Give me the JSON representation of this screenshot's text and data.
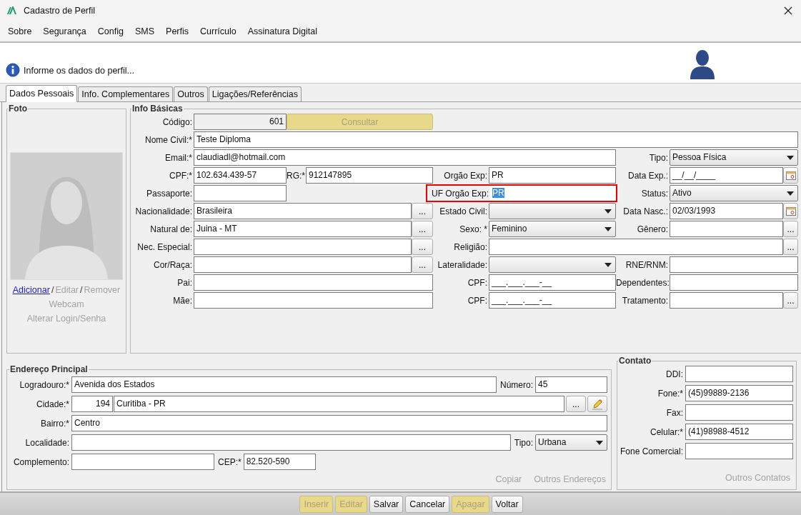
{
  "window": {
    "title": "Cadastro de Perfil"
  },
  "menu": [
    {
      "label": "Sobre"
    },
    {
      "label": "Segurança"
    },
    {
      "label": "Config"
    },
    {
      "label": "SMS"
    },
    {
      "label": "Perfis"
    },
    {
      "label": "Currículo"
    },
    {
      "label": "Assinatura Digital"
    }
  ],
  "header": {
    "message": "Informe os dados do perfil..."
  },
  "tabs": [
    {
      "label": "Dados Pessoais",
      "selected": true
    },
    {
      "label": "Info. Complementares",
      "selected": false
    },
    {
      "label": "Outros",
      "selected": false
    },
    {
      "label": "Ligações/Referências",
      "selected": false
    }
  ],
  "foto": {
    "title": "Foto",
    "actions": [
      {
        "kind": "link",
        "label": "Adicionar",
        "disabled": false
      },
      {
        "kind": "separator",
        "label": "/"
      },
      {
        "kind": "link",
        "label": "Editar",
        "disabled": true
      },
      {
        "kind": "separator",
        "label": "/"
      },
      {
        "kind": "link",
        "label": "Remover",
        "disabled": true
      }
    ],
    "more_links": [
      {
        "label": "Webcam",
        "disabled": true
      },
      {
        "label": "Alterar Login/Senha",
        "disabled": true
      }
    ]
  },
  "info_basicas": {
    "title": "Info Básicas",
    "fields": [
      {
        "kind": "number",
        "label": "Código:",
        "value": "601",
        "readonly": true
      },
      {
        "kind": "button",
        "label": "Consultar",
        "disabled": true
      },
      {
        "kind": "text",
        "label": "Nome Civil:*",
        "value": "Teste Diploma"
      },
      {
        "kind": "text",
        "label": "Email:*",
        "value": "claudiadl@hotmail.com"
      },
      {
        "kind": "select",
        "label": "Tipo:",
        "value": "Pessoa Física"
      },
      {
        "kind": "text",
        "label": "CPF:*",
        "value": "102.634.439-57"
      },
      {
        "kind": "text",
        "label": "RG:*",
        "value": "912147895"
      },
      {
        "kind": "text",
        "label": "Orgão Exp:",
        "value": "PR"
      },
      {
        "kind": "date",
        "label": "Data Exp.:",
        "value": "__/__/____"
      },
      {
        "kind": "text",
        "label": "Passaporte:"
      },
      {
        "kind": "text",
        "label": "UF Orgão Exp:",
        "value": "PR",
        "highlighted": true,
        "text_selected": true
      },
      {
        "kind": "select",
        "label": "Status:",
        "value": "Ativo"
      },
      {
        "kind": "lookup",
        "label": "Nacionalidade:",
        "value": "Brasileira",
        "button": "..."
      },
      {
        "kind": "select",
        "label": "Estado Civil:"
      },
      {
        "kind": "date",
        "label": "Data Nasc.:",
        "value": "02/03/1993"
      },
      {
        "kind": "lookup",
        "label": "Natural de:",
        "value": "Juina - MT",
        "button": "..."
      },
      {
        "kind": "select",
        "label": "Sexo: *",
        "value": "Feminino"
      },
      {
        "kind": "lookup",
        "label": "Gênero:",
        "button": "..."
      },
      {
        "kind": "lookup",
        "label": "Nec. Especial:",
        "button": "..."
      },
      {
        "kind": "lookup",
        "label": "Religião:",
        "button": "..."
      },
      {
        "kind": "lookup",
        "label": "Cor/Raça:",
        "button": "..."
      },
      {
        "kind": "select",
        "label": "Lateralidade:"
      },
      {
        "kind": "text",
        "label": "RNE/RNM:"
      },
      {
        "kind": "text",
        "label": "Pai:"
      },
      {
        "kind": "text",
        "label": "CPF:",
        "value": "___.___.___-__"
      },
      {
        "kind": "text",
        "label": "Dependentes:"
      },
      {
        "kind": "text",
        "label": "Mãe:"
      },
      {
        "kind": "text",
        "label": "CPF:",
        "value": "___.___.___-__"
      },
      {
        "kind": "lookup",
        "label": "Tratamento:",
        "button": "..."
      }
    ]
  },
  "endereco": {
    "title": "Endereço Principal",
    "rows": [
      [
        {
          "kind": "label",
          "label": "Logradouro:*"
        },
        {
          "kind": "text",
          "value": "Avenida dos Estados"
        },
        {
          "kind": "label",
          "label": "Número:"
        },
        {
          "kind": "text",
          "value": "45"
        }
      ],
      [
        {
          "kind": "label",
          "label": "Cidade:*"
        },
        {
          "kind": "number",
          "value": "194"
        },
        {
          "kind": "text",
          "value": "Curitiba - PR"
        },
        {
          "kind": "button",
          "label": "..."
        },
        {
          "kind": "edit_button"
        }
      ],
      [
        {
          "kind": "label",
          "label": "Bairro:*"
        },
        {
          "kind": "text",
          "value": "Centro"
        }
      ],
      [
        {
          "kind": "label",
          "label": "Localidade:"
        },
        {
          "kind": "text"
        },
        {
          "kind": "label",
          "label": "Tipo:"
        },
        {
          "kind": "select",
          "value": "Urbana"
        }
      ],
      [
        {
          "kind": "label",
          "label": "Complemento:"
        },
        {
          "kind": "text"
        },
        {
          "kind": "label",
          "label": "CEP:*"
        },
        {
          "kind": "text",
          "value": "82.520-590"
        }
      ]
    ],
    "links": [
      {
        "label": "Copiar",
        "disabled": true
      },
      {
        "label": "Outros Endereços",
        "disabled": true
      }
    ]
  },
  "contato": {
    "title": "Contato",
    "fields": [
      {
        "label": "DDI:"
      },
      {
        "label": "Fone:*",
        "value": "(45)99889-2136"
      },
      {
        "label": "Fax:"
      },
      {
        "label": "Celular:*",
        "value": "(41)98988-4512"
      },
      {
        "label": "Fone Comercial:"
      }
    ],
    "links": [
      {
        "label": "Outros Contatos",
        "disabled": true
      }
    ]
  },
  "buttons": [
    {
      "label": "Inserir",
      "disabled": true
    },
    {
      "label": "Editar",
      "disabled": true
    },
    {
      "label": "Salvar",
      "disabled": false
    },
    {
      "label": "Cancelar",
      "disabled": false
    },
    {
      "label": "Apagar",
      "disabled": true
    },
    {
      "label": "Voltar",
      "disabled": false
    }
  ]
}
